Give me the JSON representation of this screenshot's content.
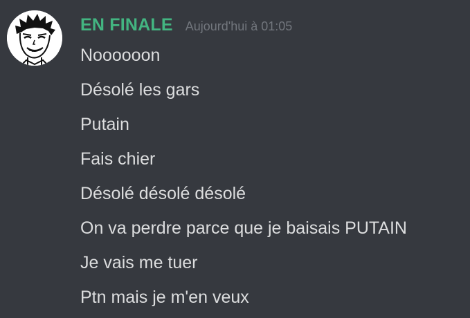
{
  "message": {
    "username": "EN FINALE",
    "timestamp": "Aujourd'hui à 01:05",
    "lines": [
      "Noooooon",
      "Désolé les gars",
      "Putain",
      "Fais chier",
      "Désolé désolé désolé",
      "On va perdre parce que je baisais PUTAIN",
      "Je vais me tuer",
      "Ptn mais je m'en veux"
    ]
  },
  "colors": {
    "background": "#36393f",
    "username": "#43b581",
    "timestamp": "#72767d",
    "text": "#dcddde"
  },
  "icons": {
    "avatar": "manga-face-avatar-icon"
  }
}
